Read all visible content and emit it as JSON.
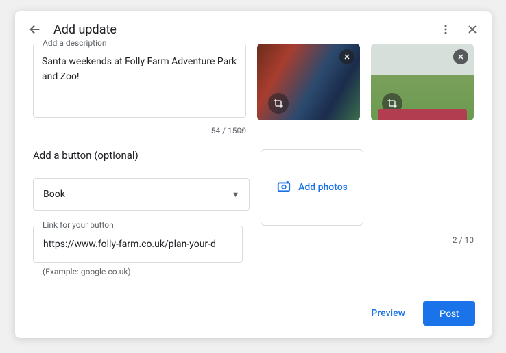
{
  "header": {
    "title": "Add update"
  },
  "description": {
    "label": "Add a description",
    "value": "Santa weekends at Folly Farm Adventure Park and Zoo!",
    "counter": "54 / 1500"
  },
  "button_section": {
    "label": "Add a button (optional)",
    "selected": "Book",
    "link_label": "Link for your button",
    "link_value": "https://www.folly-farm.co.uk/plan-your-d",
    "example": "(Example: google.co.uk)"
  },
  "photos": {
    "add_label": "Add photos",
    "counter": "2 / 10"
  },
  "footer": {
    "preview": "Preview",
    "post": "Post"
  }
}
